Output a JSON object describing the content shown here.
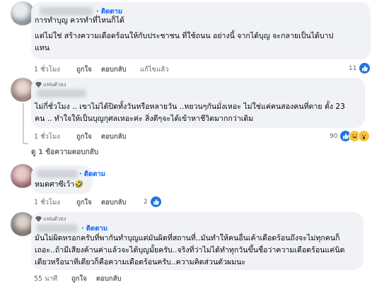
{
  "comments": [
    {
      "follow_label": "· ติดตาม",
      "lines": [
        "การทำบุญ ควรทำที่ไหนก็ได้",
        "แต่ไม่ใช่ สร้างความเดือดร้อนให้กับประชาชน ที่ใช้ถนน อย่างนี้ จากได้บุญ จะกลายเป็นได้บาป",
        "แทน"
      ],
      "time": "1 ชั่วโมง",
      "like": "ถูกใจ",
      "reply": "ตอบกลับ",
      "edited": "แก้ไขแล้ว",
      "reaction_count": "11"
    },
    {
      "badge": "แฟนตัวยง",
      "lines": [
        "ไม่กี่ชั่วโมง .. เขาไม่ได้ปิดทั้งวันหรือหลายวัน ..หยวนๆกันมั่งเหอะ ไม่ใช่แค่คนสองคนที่ตาย ตั้ง 23",
        "คน .. ทำใจให้เป็นบุญกุศลเหอะค่ะ สิ่งดีๆจะได้เข้าหาชีวิตมากกว่าเดิม"
      ],
      "time": "1 ชั่วโมง",
      "like": "ถูกใจ",
      "reply": "ตอบกลับ",
      "reaction_count": "90",
      "view_replies": "ดู 1 ข้อความตอบกลับ"
    },
    {
      "follow_label": "· ติดตาม",
      "lines": [
        "หมดศาซีเว้า🤣"
      ],
      "time": "1 ชั่วโมง",
      "like": "ถูกใจ",
      "reply": "ตอบกลับ",
      "reaction_count": "2"
    },
    {
      "badge": "แฟนตัวยง",
      "follow_label": "· ติดตาม",
      "lines": [
        "มันไม่ผิดหรอกครับที่พากันทำบุญแต่มันผิดที่สถานที่..มันทำให้คนอื่นเค้าเดือดร้อนถึงจะไม่ทุกคนก็",
        "เถอะ..ถ้ามีเสียงค้านค่าแล้วจะได้บุญมั้ยครับ..จริงที่ว่าไม่ได้ทำทุกวันขึ้นชื่อว่าความเดือดร้อนแค่นิด",
        "เดียวหรือนาทีเดียวก็คือความเดือดร้อนครับ..ความคิดส่วนตัวผมนะ"
      ],
      "time": "55 นาที",
      "like": "ถูกใจ",
      "reply": "ตอบกลับ"
    }
  ],
  "icons": {
    "like": "like-icon",
    "haha": "haha-icon",
    "badge": "diamond-badge-icon"
  },
  "colors": {
    "bubble": "#f0f2f5",
    "link": "#0866ff",
    "meta": "#65676b",
    "like": "#1b74e4"
  }
}
